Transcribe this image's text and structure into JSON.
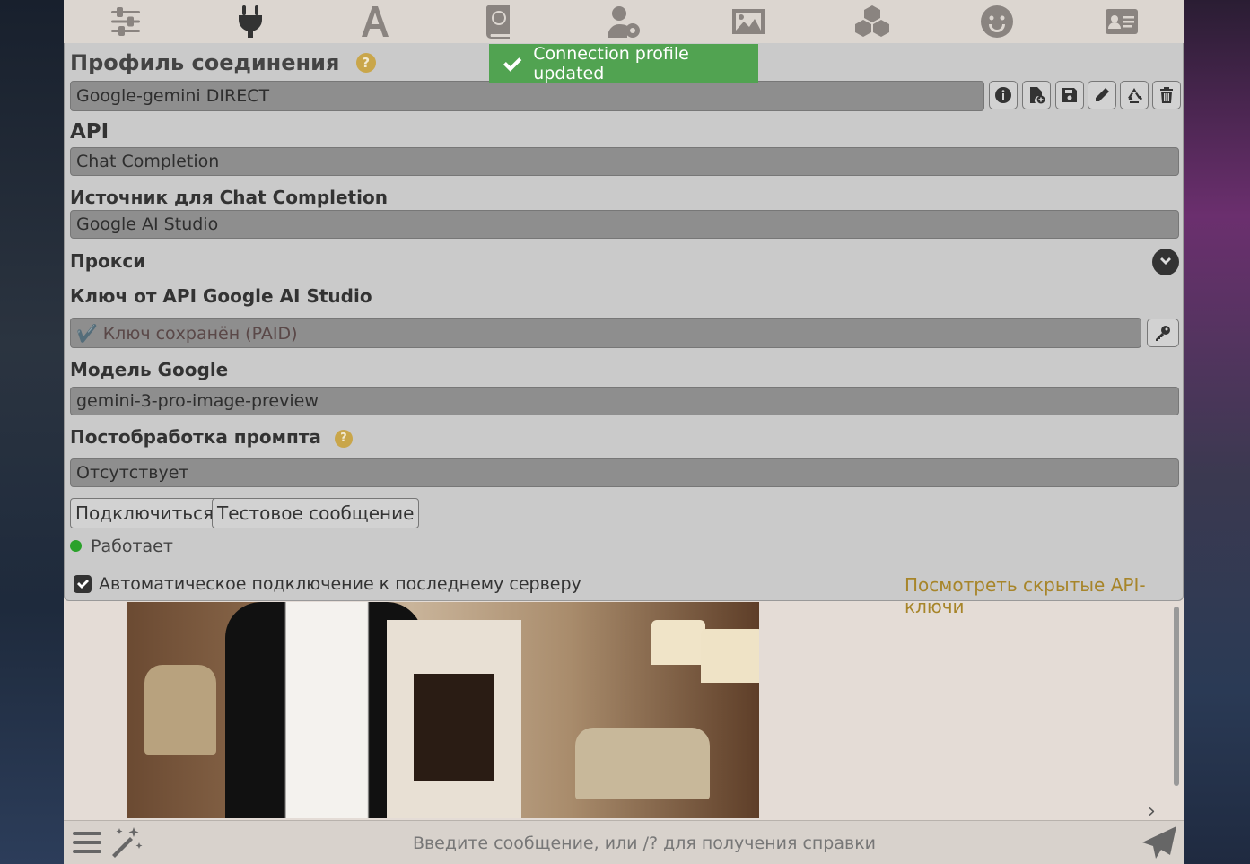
{
  "toast": {
    "message": "Connection profile updated"
  },
  "nav": {
    "icons": [
      "sliders-icon",
      "plug-icon",
      "font-a-icon",
      "book-globe-icon",
      "user-gear-icon",
      "image-icon",
      "cubes-icon",
      "smile-icon",
      "id-card-icon"
    ],
    "active": "plug-icon"
  },
  "panel": {
    "title": "Профиль соединения",
    "help": "?",
    "profile": {
      "value": "Google-gemini DIRECT"
    },
    "profile_buttons": [
      "info-icon",
      "file-plus-icon",
      "floppy-disk-icon",
      "pencil-icon",
      "recycle-icon",
      "trash-icon"
    ],
    "api": {
      "label": "API",
      "value": "Chat Completion"
    },
    "source": {
      "label": "Источник для Chat Completion",
      "value": "Google AI Studio"
    },
    "proxy": {
      "label": "Прокси"
    },
    "api_key": {
      "label": "Ключ от API Google AI Studio",
      "value": "✔️ Ключ сохранён (PAID)"
    },
    "model": {
      "label": "Модель Google",
      "value": "gemini-3-pro-image-preview"
    },
    "postprocess": {
      "label": "Постобработка промпта",
      "value": "Отсутствует"
    },
    "buttons": {
      "connect": "Подключиться",
      "test": "Тестовое сообщение"
    },
    "status": {
      "text": "Работает",
      "color": "#2aa12a"
    },
    "auto_connect": {
      "label": "Автоматическое подключение к последнему серверу",
      "checked": true
    },
    "hidden_keys_link": "Посмотреть скрытые API-ключи"
  },
  "chat": {
    "input_placeholder": "Введите сообщение, или /? для получения справки"
  },
  "colors": {
    "accent_link": "#a7852a",
    "toast_bg": "#51a351",
    "help_badge": "#c9a64a"
  }
}
